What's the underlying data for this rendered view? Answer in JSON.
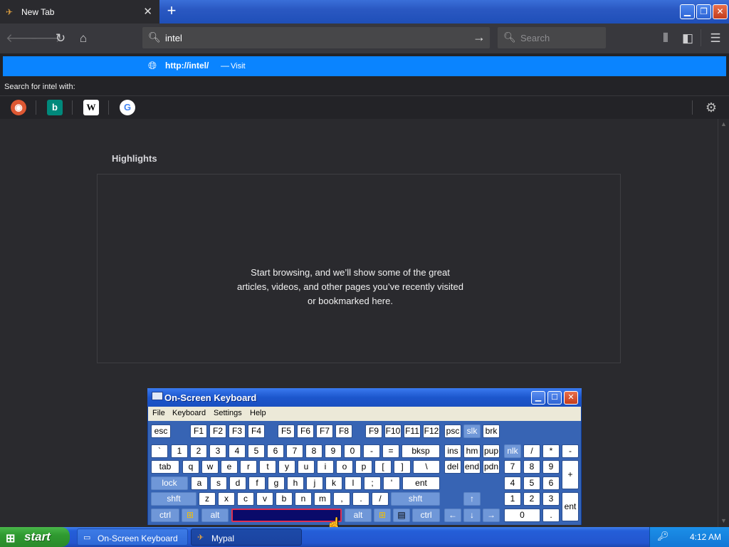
{
  "browser": {
    "tab_title": "New Tab",
    "tab_close": "✕",
    "new_tab": "+",
    "url_value": "intel",
    "search_placeholder": "Search"
  },
  "suggestion": {
    "url": "http://intel/",
    "dash": "—",
    "action": "Visit"
  },
  "search_for": "Search for intel  with:",
  "engines": [
    {
      "name": "duckduckgo",
      "glyph": "◉",
      "color": "#de5833"
    },
    {
      "name": "bing",
      "glyph": "b",
      "color": "#00897b"
    },
    {
      "name": "wikipedia",
      "glyph": "W",
      "color": "#000000"
    },
    {
      "name": "google",
      "glyph": "G",
      "color": "#4285f4"
    }
  ],
  "content": {
    "highlights_title": "Highlights",
    "empty_message": "Start browsing, and we’ll show some of the great articles, videos, and other pages you’ve recently visited or bookmarked here."
  },
  "osk": {
    "title": "On-Screen Keyboard",
    "menu": [
      "File",
      "Keyboard",
      "Settings",
      "Help"
    ],
    "keys": {
      "esc": "esc",
      "f1": "F1",
      "f2": "F2",
      "f3": "F3",
      "f4": "F4",
      "f5": "F5",
      "f6": "F6",
      "f7": "F7",
      "f8": "F8",
      "f9": "F9",
      "f10": "F10",
      "f11": "F11",
      "f12": "F12",
      "psc": "psc",
      "slk": "slk",
      "brk": "brk",
      "row1": [
        "`",
        "1",
        "2",
        "3",
        "4",
        "5",
        "6",
        "7",
        "8",
        "9",
        "0",
        "-",
        "="
      ],
      "bksp": "bksp",
      "ins": "ins",
      "hm": "hm",
      "pup": "pup",
      "nlk": "nlk",
      "div": "/",
      "mul": "*",
      "sub": "-",
      "tab": "tab",
      "row2": [
        "q",
        "w",
        "e",
        "r",
        "t",
        "y",
        "u",
        "i",
        "o",
        "p",
        "[",
        "]",
        "\\"
      ],
      "del": "del",
      "end": "end",
      "pdn": "pdn",
      "n7": "7",
      "n8": "8",
      "n9": "9",
      "add": "+",
      "lock": "lock",
      "row3": [
        "a",
        "s",
        "d",
        "f",
        "g",
        "h",
        "j",
        "k",
        "l",
        ";",
        "'"
      ],
      "ent": "ent",
      "n4": "4",
      "n5": "5",
      "n6": "6",
      "shft": "shft",
      "row4": [
        "z",
        "x",
        "c",
        "v",
        "b",
        "n",
        "m",
        ",",
        ".",
        "/"
      ],
      "up": "↑",
      "n1": "1",
      "n2": "2",
      "n3": "3",
      "nent": "ent",
      "ctrl": "ctrl",
      "alt": "alt",
      "left": "←",
      "down": "↓",
      "right": "→",
      "n0": "0",
      "dot": "."
    }
  },
  "taskbar": {
    "start": "start",
    "tasks": [
      "On-Screen Keyboard",
      "Mypal"
    ],
    "clock": "4:12 AM"
  }
}
